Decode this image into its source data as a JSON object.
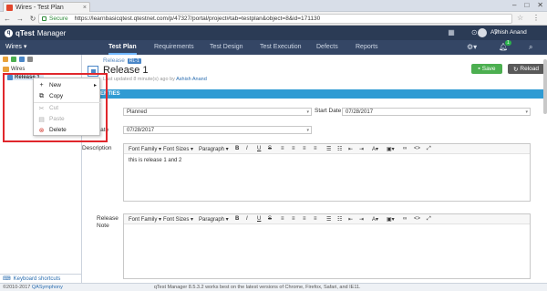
{
  "browser": {
    "tab_title": "Wires - Test Plan",
    "secure_label": "Secure",
    "url": "https://learnbasicqtest.qtestnet.com/p/47327/portal/project#tab=testplan&object=8&id=171130"
  },
  "app": {
    "name": "qTest",
    "subtitle": "Manager",
    "user_name": "Ashish Anand"
  },
  "nav": {
    "project": "Wires ▾",
    "tabs": [
      "Test Plan",
      "Requirements",
      "Test Design",
      "Test Execution",
      "Defects",
      "Reports"
    ],
    "notifications": "1"
  },
  "tree": {
    "root_label": "Wires",
    "release_label": "Release 1",
    "keyboard_shortcuts": "Keyboard shortcuts"
  },
  "context_menu": {
    "items": [
      "New",
      "Copy",
      "Cut",
      "Paste",
      "Delete"
    ]
  },
  "release": {
    "breadcrumb": "Release",
    "badge": "RL-1",
    "title": "Release 1",
    "last_updated_prefix": "Last updated 8 minute(s) ago by",
    "last_updated_user": "Ashish Anand",
    "save_label": "Save",
    "reload_label": "Reload",
    "section": "PROPERTIES",
    "status_label": "tus",
    "status_value": "Planned",
    "start_date_label": "Start Date",
    "start_date_value": "07/28/2017",
    "end_date_label": "d Date",
    "end_date_value": "07/28/2017",
    "description_label": "Description",
    "description_value": "this is release 1 and 2",
    "release_note_label": "Release Note"
  },
  "editor_toolbar": {
    "font_family": "Font Family ▾",
    "font_sizes": "Font Sizes ▾",
    "paragraph": "Paragraph ▾",
    "bold": "B",
    "italic": "I",
    "underline": "U",
    "strike": "S"
  },
  "footer": {
    "copyright": "©2010-2017",
    "company": "QASymphony",
    "note": "qTest Manager 8.5.3.2 works best on the latest versions of Chrome, Firefox, Safari, and IE11."
  }
}
